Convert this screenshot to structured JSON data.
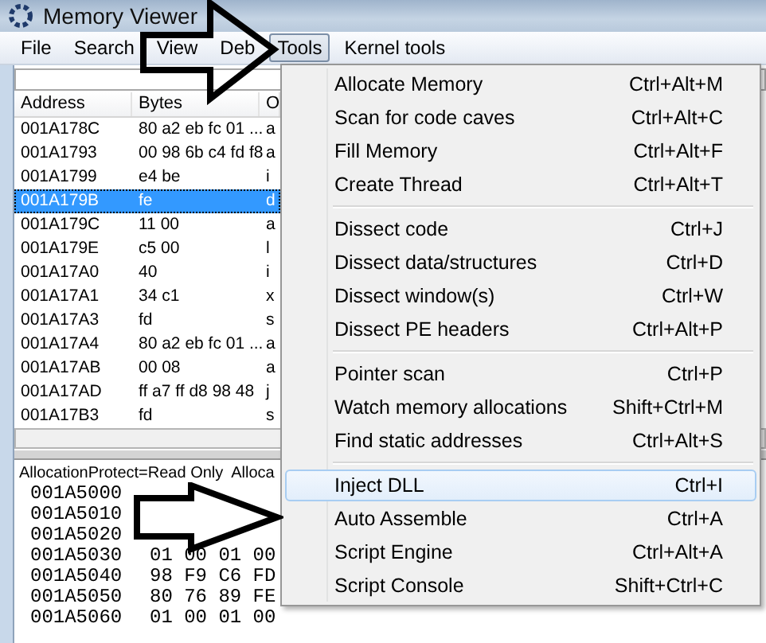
{
  "window": {
    "title": "Memory Viewer"
  },
  "menu_bar": [
    {
      "label": "File",
      "selected": false
    },
    {
      "label": "Search",
      "selected": false
    },
    {
      "label": "View",
      "selected": false
    },
    {
      "label": "Deb",
      "selected": false
    },
    {
      "label": "Tools",
      "selected": true
    },
    {
      "label": "Kernel tools",
      "selected": false
    }
  ],
  "disassembly": {
    "columns": [
      "Address",
      "Bytes",
      "O"
    ],
    "rows": [
      {
        "address": "001A178C",
        "bytes": "80 a2 eb fc 01 ...",
        "column_3": "a",
        "selected": false
      },
      {
        "address": "001A1793",
        "bytes": "00 98 6b c4 fd f8",
        "column_3": "a",
        "selected": false
      },
      {
        "address": "001A1799",
        "bytes": "e4 be",
        "column_3": "i",
        "selected": false
      },
      {
        "address": "001A179B",
        "bytes": "fe",
        "column_3": "d",
        "selected": true
      },
      {
        "address": "001A179C",
        "bytes": "11 00",
        "column_3": "a",
        "selected": false
      },
      {
        "address": "001A179E",
        "bytes": "c5 00",
        "column_3": "l",
        "selected": false
      },
      {
        "address": "001A17A0",
        "bytes": "40",
        "column_3": "i",
        "selected": false
      },
      {
        "address": "001A17A1",
        "bytes": "34 c1",
        "column_3": "x",
        "selected": false
      },
      {
        "address": "001A17A3",
        "bytes": "fd",
        "column_3": "s",
        "selected": false
      },
      {
        "address": "001A17A4",
        "bytes": "80 a2 eb fc 01 ...",
        "column_3": "a",
        "selected": false
      },
      {
        "address": "001A17AB",
        "bytes": "00 08",
        "column_3": "a",
        "selected": false
      },
      {
        "address": "001A17AD",
        "bytes": "ff a7 ff d8 98 48",
        "column_3": "j",
        "selected": false
      },
      {
        "address": "001A17B3",
        "bytes": "fd",
        "column_3": "s",
        "selected": false
      }
    ]
  },
  "hex_view": {
    "header": "AllocationProtect=Read Only  Alloca",
    "rows": [
      {
        "address": "001A5000"
      },
      {
        "address": "001A5010"
      },
      {
        "address": "001A5020"
      },
      {
        "address": "001A5030",
        "bytes": "01 00 01 00"
      },
      {
        "address": "001A5040",
        "bytes": "98 F9 C6 FD"
      },
      {
        "address": "001A5050",
        "bytes": "80 76 89 FE"
      },
      {
        "address": "001A5060",
        "bytes": "01 00 01 00"
      }
    ]
  },
  "tools_menu": {
    "groups": [
      [
        {
          "label": "Allocate Memory",
          "shortcut": "Ctrl+Alt+M",
          "selected": false
        },
        {
          "label": "Scan for code caves",
          "shortcut": "Ctrl+Alt+C",
          "selected": false
        },
        {
          "label": "Fill Memory",
          "shortcut": "Ctrl+Alt+F",
          "selected": false
        },
        {
          "label": "Create Thread",
          "shortcut": "Ctrl+Alt+T",
          "selected": false
        }
      ],
      [
        {
          "label": "Dissect code",
          "shortcut": "Ctrl+J",
          "selected": false
        },
        {
          "label": "Dissect data/structures",
          "shortcut": "Ctrl+D",
          "selected": false
        },
        {
          "label": "Dissect window(s)",
          "shortcut": "Ctrl+W",
          "selected": false
        },
        {
          "label": "Dissect PE headers",
          "shortcut": "Ctrl+Alt+P",
          "selected": false
        }
      ],
      [
        {
          "label": "Pointer scan",
          "shortcut": "Ctrl+P",
          "selected": false
        },
        {
          "label": "Watch memory allocations",
          "shortcut": "Shift+Ctrl+M",
          "selected": false
        },
        {
          "label": "Find static addresses",
          "shortcut": "Ctrl+Alt+S",
          "selected": false
        }
      ],
      [
        {
          "label": "Inject DLL",
          "shortcut": "Ctrl+I",
          "selected": true
        },
        {
          "label": "Auto Assemble",
          "shortcut": "Ctrl+A",
          "selected": false
        },
        {
          "label": "Script Engine",
          "shortcut": "Ctrl+Alt+A",
          "selected": false
        },
        {
          "label": "Script Console",
          "shortcut": "Shift+Ctrl+C",
          "selected": false
        }
      ]
    ]
  }
}
